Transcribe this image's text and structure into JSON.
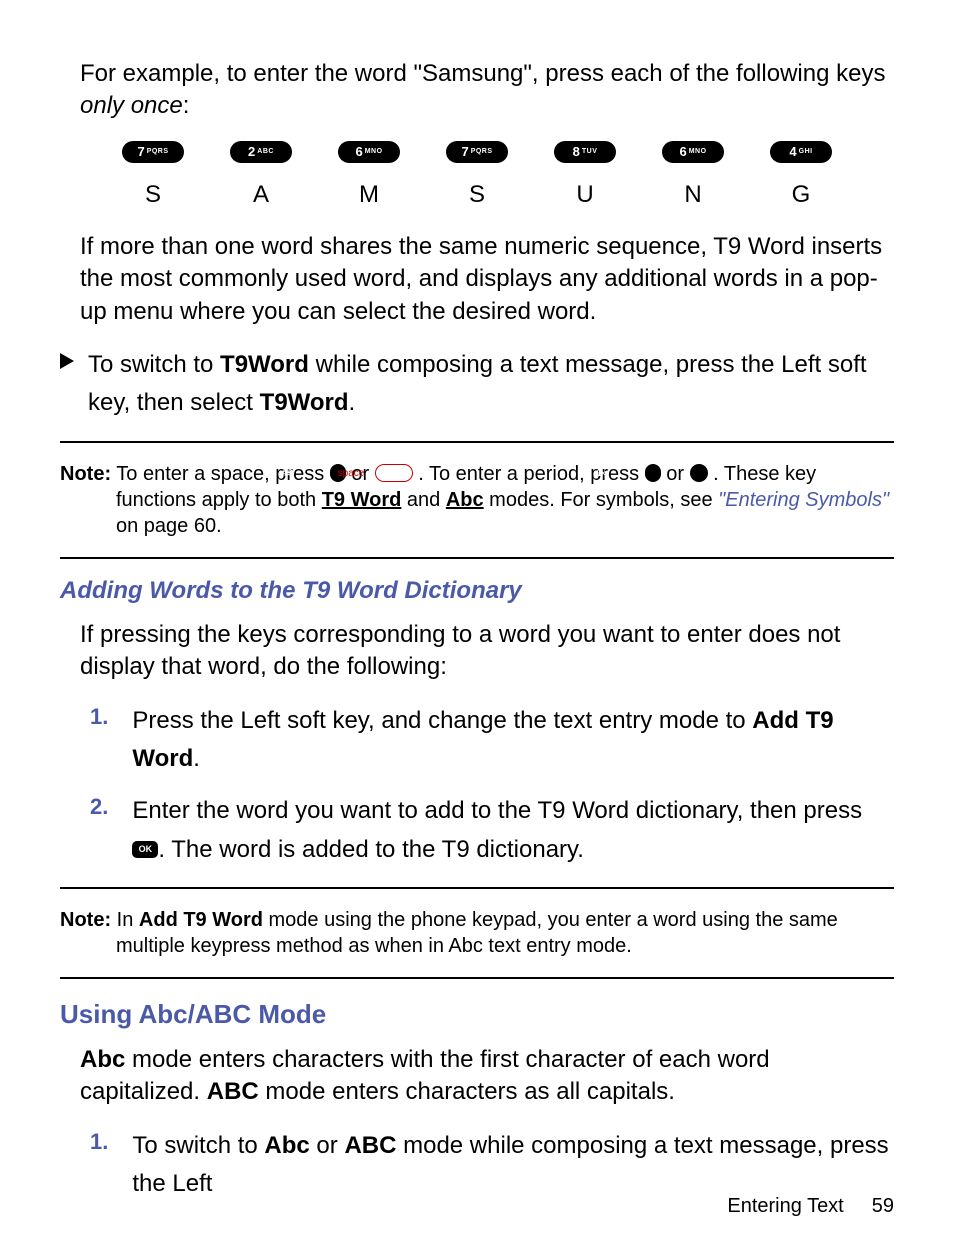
{
  "intro": {
    "pre": "For example, to enter the word \"Samsung\", press each of the following keys ",
    "emph": "only once",
    "post": ":"
  },
  "keys": [
    {
      "big": "7",
      "small": "PQRS",
      "letter": "S"
    },
    {
      "big": "2",
      "small": "ABC",
      "letter": "A"
    },
    {
      "big": "6",
      "small": "MNO",
      "letter": "M"
    },
    {
      "big": "7",
      "small": "PQRS",
      "letter": "S"
    },
    {
      "big": "8",
      "small": "TUV",
      "letter": "U"
    },
    {
      "big": "6",
      "small": "MNO",
      "letter": "N"
    },
    {
      "big": "4",
      "small": "GHI",
      "letter": "G"
    }
  ],
  "para2": "If more than one word shares the same numeric sequence, T9 Word inserts the most commonly used word, and displays any additional words in a pop-up menu where you can select the desired word.",
  "bullet": {
    "a": "To switch to ",
    "b": "T9Word",
    "c": " while composing a text message, press the Left soft key, then select ",
    "d": "T9Word",
    "e": "."
  },
  "note1": {
    "label": "Note:",
    "a": " To enter a space, press ",
    "icon_hash": "#",
    "or1": " or ",
    "icon_space": "space",
    "b": " . To enter a period, press ",
    "icon_one": "1",
    "or2": " or ",
    "icon_dot": ".",
    "c": " . These key functions apply to both ",
    "mode1": "T9 Word",
    "and": " and ",
    "mode2": "Abc",
    "d": " modes. For symbols, see ",
    "ref": "\"Entering Symbols\"",
    "e": " on page 60."
  },
  "h_add": "Adding Words to the T9 Word Dictionary",
  "para3": "If pressing the keys corresponding to a word you want to enter does not display that word, do the following:",
  "steps1": [
    {
      "num": "1.",
      "a": "Press the Left soft key, and change the text entry mode to ",
      "b": "Add T9 Word",
      "c": "."
    },
    {
      "num": "2.",
      "a": "Enter the word you want to add to the T9 Word dictionary, then press ",
      "ok": "OK",
      "b": ". The word is added to the T9 dictionary."
    }
  ],
  "note2": {
    "label": "Note:",
    "a": " In ",
    "b": "Add T9 Word",
    "c": " mode using the phone keypad, you enter a word using the same multiple keypress method as when in Abc text entry mode."
  },
  "h_abc": "Using Abc/ABC Mode",
  "para4": {
    "a": "Abc",
    "b": " mode enters characters with the first character of each word capitalized.  ",
    "c": "ABC",
    "d": " mode enters characters as all capitals."
  },
  "steps2": [
    {
      "num": "1.",
      "a": "To switch to ",
      "b": "Abc",
      "c": " or ",
      "d": "ABC",
      "e": " mode while composing a text message, press the Left"
    }
  ],
  "footer": {
    "label": "Entering Text",
    "page": "59"
  }
}
